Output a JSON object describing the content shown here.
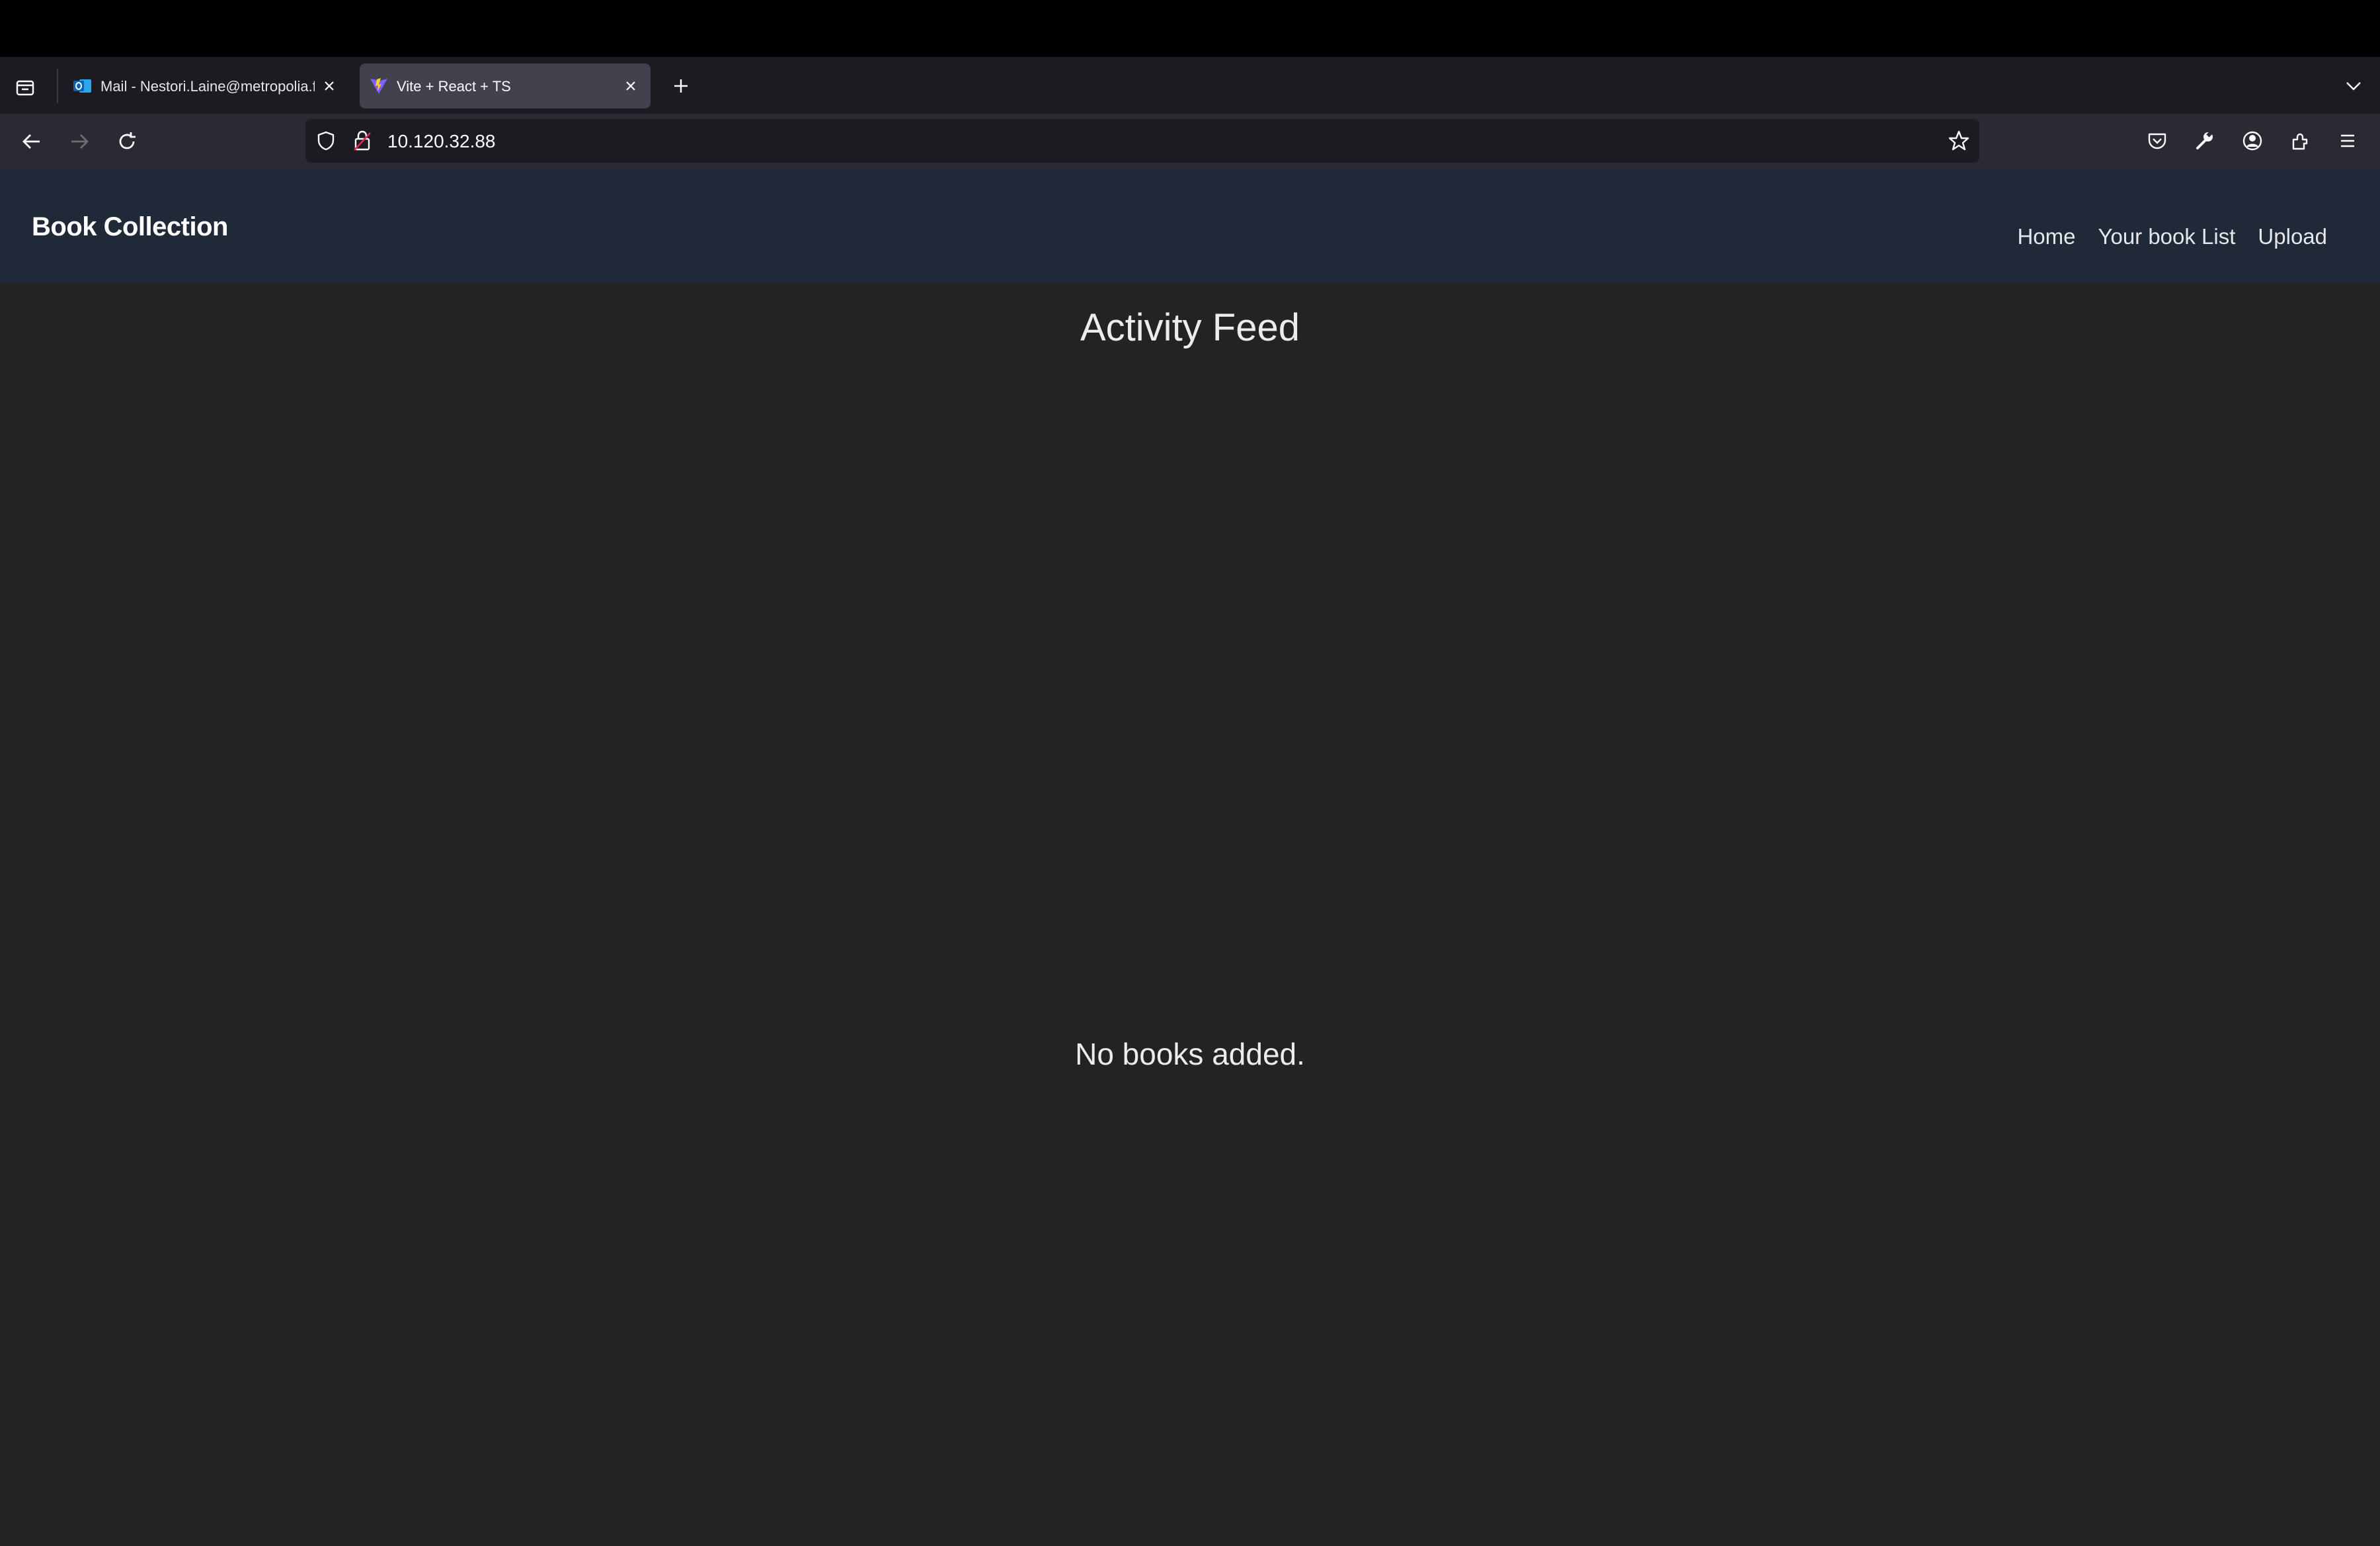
{
  "browser": {
    "tabs": [
      {
        "title": "Mail - Nestori.Laine@metropolia.fi",
        "active": false,
        "favicon": "outlook-icon"
      },
      {
        "title": "Vite + React + TS",
        "active": true,
        "favicon": "vite-icon"
      }
    ],
    "url": "10.120.32.88"
  },
  "app": {
    "brand": "Book Collection",
    "nav": [
      "Home",
      "Your book List",
      "Upload"
    ],
    "page_title": "Activity Feed",
    "empty_message": "No books added."
  },
  "colors": {
    "page_bg": "#232323",
    "header_bg": "#1f2937",
    "browser_chrome": "#2b2a33",
    "tab_active": "#42414d"
  }
}
